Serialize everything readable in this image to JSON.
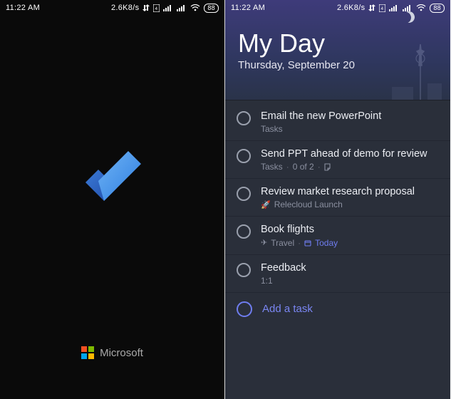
{
  "statusbar": {
    "time": "11:22 AM",
    "speed": "2.6K8/s",
    "battery": "88"
  },
  "left": {
    "brand": "Microsoft"
  },
  "right": {
    "title": "My Day",
    "date": "Thursday, September 20",
    "tasks": [
      {
        "title": "Email  the new PowerPoint",
        "sub_prefix": "Tasks",
        "progress": "",
        "icon": "",
        "tag": "",
        "due": ""
      },
      {
        "title": "Send PPT ahead of demo for review",
        "sub_prefix": "Tasks",
        "progress": "0 of 2",
        "icon": "note",
        "tag": "",
        "due": ""
      },
      {
        "title": "Review market research proposal",
        "sub_prefix": "",
        "progress": "",
        "icon": "rocket",
        "tag": "Relecloud Launch",
        "due": ""
      },
      {
        "title": "Book flights",
        "sub_prefix": "",
        "progress": "",
        "icon": "plane",
        "tag": "Travel",
        "due": "Today"
      },
      {
        "title": "Feedback",
        "sub_prefix": "1:1",
        "progress": "",
        "icon": "",
        "tag": "",
        "due": ""
      }
    ],
    "add_label": "Add a task"
  }
}
